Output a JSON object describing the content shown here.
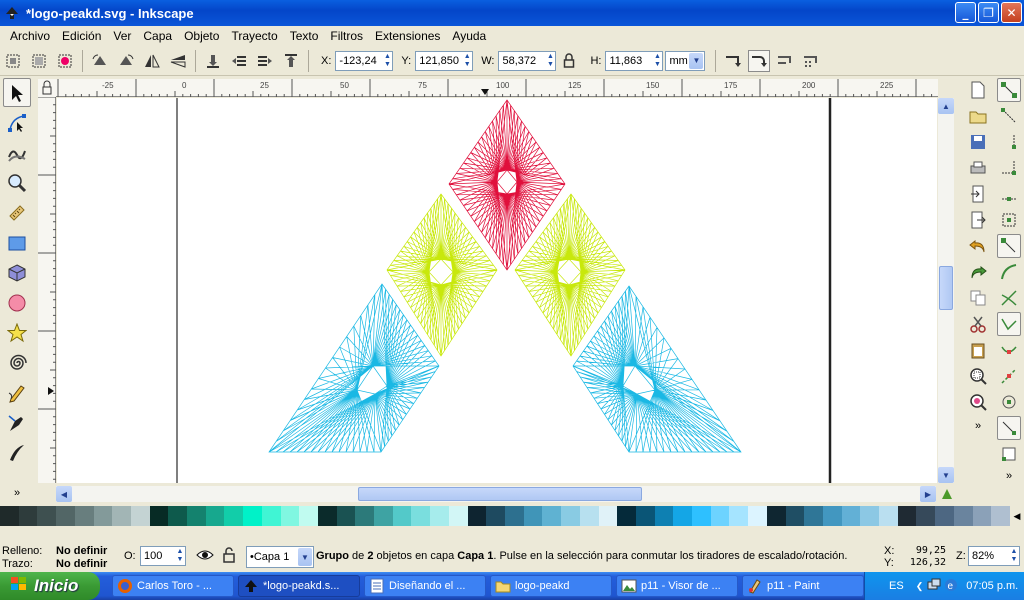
{
  "window": {
    "title": "*logo-peakd.svg - Inkscape"
  },
  "menu": [
    "Archivo",
    "Edición",
    "Ver",
    "Capa",
    "Objeto",
    "Trayecto",
    "Texto",
    "Filtros",
    "Extensiones",
    "Ayuda"
  ],
  "controls": {
    "x_label": "X:",
    "x_value": "-123,24",
    "y_label": "Y:",
    "y_value": "121,850",
    "w_label": "W:",
    "w_value": "58,372",
    "h_label": "H:",
    "h_value": "11,863",
    "unit": "mm"
  },
  "ruler": {
    "h_ticks": [
      "-25",
      "0",
      "25",
      "50",
      "75",
      "100",
      "125",
      "150",
      "175",
      "200",
      "225"
    ]
  },
  "status": {
    "fill_label": "Relleno:",
    "fill_value": "No definir",
    "stroke_label": "Trazo:",
    "stroke_value": "No definir",
    "opacity_label": "O:",
    "opacity_value": "100",
    "layer": "•Capa 1",
    "message_bold": "Grupo",
    "message_part1": " de ",
    "message_bold2": "2",
    "message_part2": " objetos en capa ",
    "message_bold3": "Capa 1",
    "message_part3": ". Pulse en la selección para conmutar los tiradores de escalado/rotación.",
    "cursor_x_label": "X:",
    "cursor_x": "99,25",
    "cursor_y_label": "Y:",
    "cursor_y": "126,32",
    "zoom_label": "Z:",
    "zoom": "82%"
  },
  "palette": [
    "#1f2a2a",
    "#2e3c3c",
    "#3e5050",
    "#526666",
    "#687e7e",
    "#839a9a",
    "#a2b5b5",
    "#c4d3d3",
    "#072b25",
    "#0e5a4c",
    "#14826e",
    "#17a88e",
    "#12cda9",
    "#00f2c8",
    "#40f5d4",
    "#80f7e1",
    "#c0fbf0",
    "#0b2b2b",
    "#1a5252",
    "#2c7a7a",
    "#3ea3a3",
    "#53c9c9",
    "#7adede",
    "#a6ecec",
    "#d2f6f6",
    "#0e2430",
    "#1e4a60",
    "#2d708f",
    "#4095b8",
    "#5fb2d2",
    "#89cbe3",
    "#b7e0ef",
    "#e0f2f8",
    "#052a3a",
    "#0a5576",
    "#0e80b2",
    "#14a6e6",
    "#2ec0ff",
    "#6dd3ff",
    "#a5e4ff",
    "#dcf4ff",
    "#0f2631",
    "#1f4e64",
    "#2f7697",
    "#4297c0",
    "#62b0d6",
    "#8cc8e4",
    "#badff0",
    "#1f2a33",
    "#36495a",
    "#4d6782",
    "#6a849e",
    "#8ba1b8",
    "#afbfd0"
  ],
  "taskbar": {
    "start": "Inicio",
    "tasks": [
      "Carlos Toro - ...",
      "*logo-peakd.s...",
      "Diseñando  el ...",
      "logo-peakd",
      "p11 - Visor de ...",
      "p11 - Paint"
    ],
    "lang": "ES",
    "clock": "07:05 p.m."
  },
  "colors": {
    "red": "#e0103c",
    "yellow": "#c8e80c",
    "cyan": "#1ab8e4"
  }
}
